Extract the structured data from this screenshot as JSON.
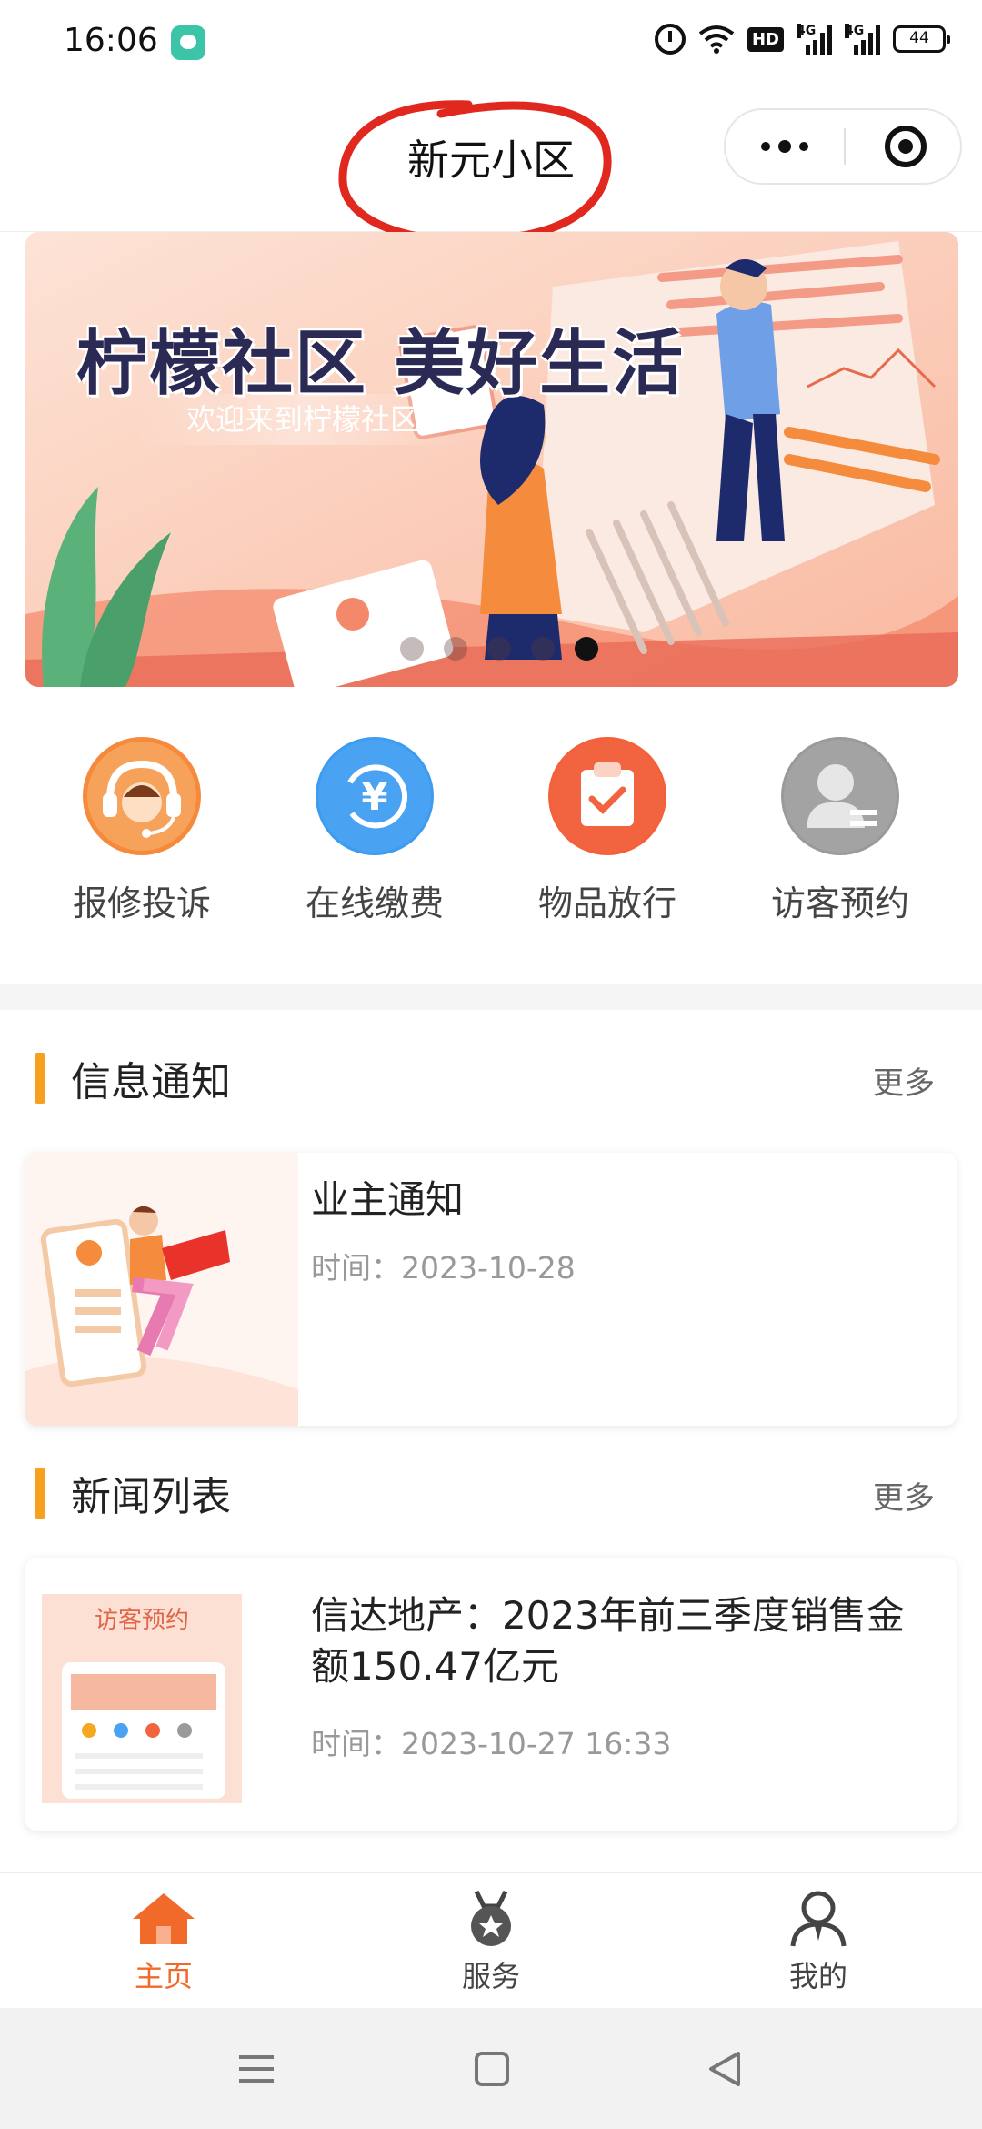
{
  "status_bar": {
    "time": "16:06",
    "network_1": "4G",
    "network_2": "4G",
    "hd": "HD",
    "battery": "44"
  },
  "nav": {
    "title": "新元小区",
    "more_icon": "more-dots-icon",
    "close_icon": "target-close-icon"
  },
  "banner": {
    "title": "柠檬社区 美好生活",
    "subtitle": "欢迎来到柠檬社区",
    "dot_count": 5,
    "active_dot": 4
  },
  "quick_menu": [
    {
      "label": "报修投诉",
      "icon": "headset-service-icon",
      "color": "#f58a3c"
    },
    {
      "label": "在线缴费",
      "icon": "yen-payment-icon",
      "color": "#3d9bf0"
    },
    {
      "label": "物品放行",
      "icon": "clipboard-check-icon",
      "color": "#f2603c"
    },
    {
      "label": "访客预约",
      "icon": "visitor-person-icon",
      "color": "#9a9a9a"
    }
  ],
  "notices": {
    "title": "信息通知",
    "more": "更多",
    "items": [
      {
        "title": "业主通知",
        "time": "时间：2023-10-28"
      }
    ]
  },
  "news": {
    "title": "新闻列表",
    "more": "更多",
    "items": [
      {
        "title": "信达地产：2023年前三季度销售金额150.47亿元",
        "time": "时间：2023-10-27 16:33",
        "thumb_text": "访客预约"
      }
    ]
  },
  "tab_bar": [
    {
      "label": "主页",
      "icon": "home-icon",
      "active": true
    },
    {
      "label": "服务",
      "icon": "service-medal-icon",
      "active": false
    },
    {
      "label": "我的",
      "icon": "profile-icon",
      "active": false
    }
  ],
  "colors": {
    "accent": "#f26a2a",
    "section_bar": "#f7a01f"
  }
}
